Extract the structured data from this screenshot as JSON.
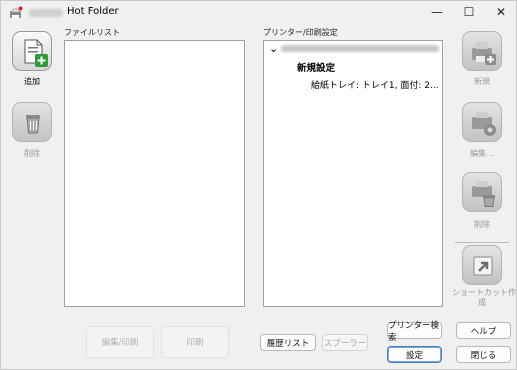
{
  "window": {
    "title": "Hot Folder",
    "controls": {
      "minimize": "—",
      "maximize": "☐",
      "close": "✕"
    }
  },
  "file_list": {
    "label": "ファイルリスト"
  },
  "printer_settings": {
    "label": "プリンター/印刷設定",
    "tree": {
      "expander": "⌄",
      "setting_name": "新規設定",
      "setting_detail": "給紙トレイ: トレイ1, 面付: 2..."
    }
  },
  "left_toolbar": {
    "add_label": "追加",
    "delete_label": "削除"
  },
  "right_toolbar": {
    "new_label": "新規",
    "edit_label": "編集...",
    "delete_label": "削除",
    "shortcut_label_line1": "ショートカット作",
    "shortcut_label_line2": "成"
  },
  "bottom_buttons": {
    "edit_print": "編集/印刷",
    "print": "印刷",
    "history": "履歴リスト",
    "spooler": "スプーラー",
    "printer_search": "プリンター検索",
    "settings": "設定",
    "help": "ヘルプ",
    "close": "閉じる"
  },
  "colors": {
    "accent_green": "#2e9a3a",
    "default_button_border": "#4a7fbf"
  }
}
